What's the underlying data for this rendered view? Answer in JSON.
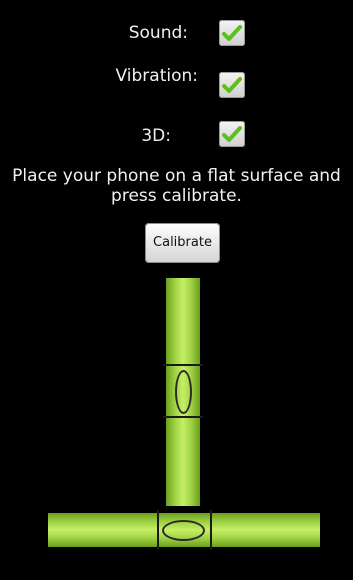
{
  "settings": {
    "sound": {
      "label": "Sound:",
      "checked": true
    },
    "vibration": {
      "label": "Vibration:",
      "checked": true
    },
    "three_d": {
      "label": "3D:",
      "checked": true
    }
  },
  "instructions": "Place your phone on a flat surface and press calibrate.",
  "calibrate_button": "Calibrate",
  "colors": {
    "background": "#000000",
    "vial_green": "#9ed043",
    "checkmark_green": "#5cbf1f"
  }
}
